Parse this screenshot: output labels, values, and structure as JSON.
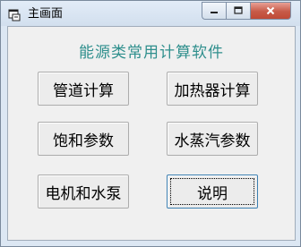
{
  "window": {
    "title": "主画面"
  },
  "titlebar_controls": {
    "minimize_icon": "minimize-icon",
    "maximize_icon": "maximize-icon",
    "close_icon": "close-icon"
  },
  "heading": "能源类常用计算软件",
  "buttons": [
    {
      "label": "管道计算"
    },
    {
      "label": "加热器计算"
    },
    {
      "label": "饱和参数"
    },
    {
      "label": "水蒸汽参数"
    },
    {
      "label": "电机和水泵"
    },
    {
      "label": "说明"
    }
  ],
  "colors": {
    "heading": "#2f8f8d",
    "close_button": "#c75a48",
    "window_frame": "#dce7f3"
  }
}
